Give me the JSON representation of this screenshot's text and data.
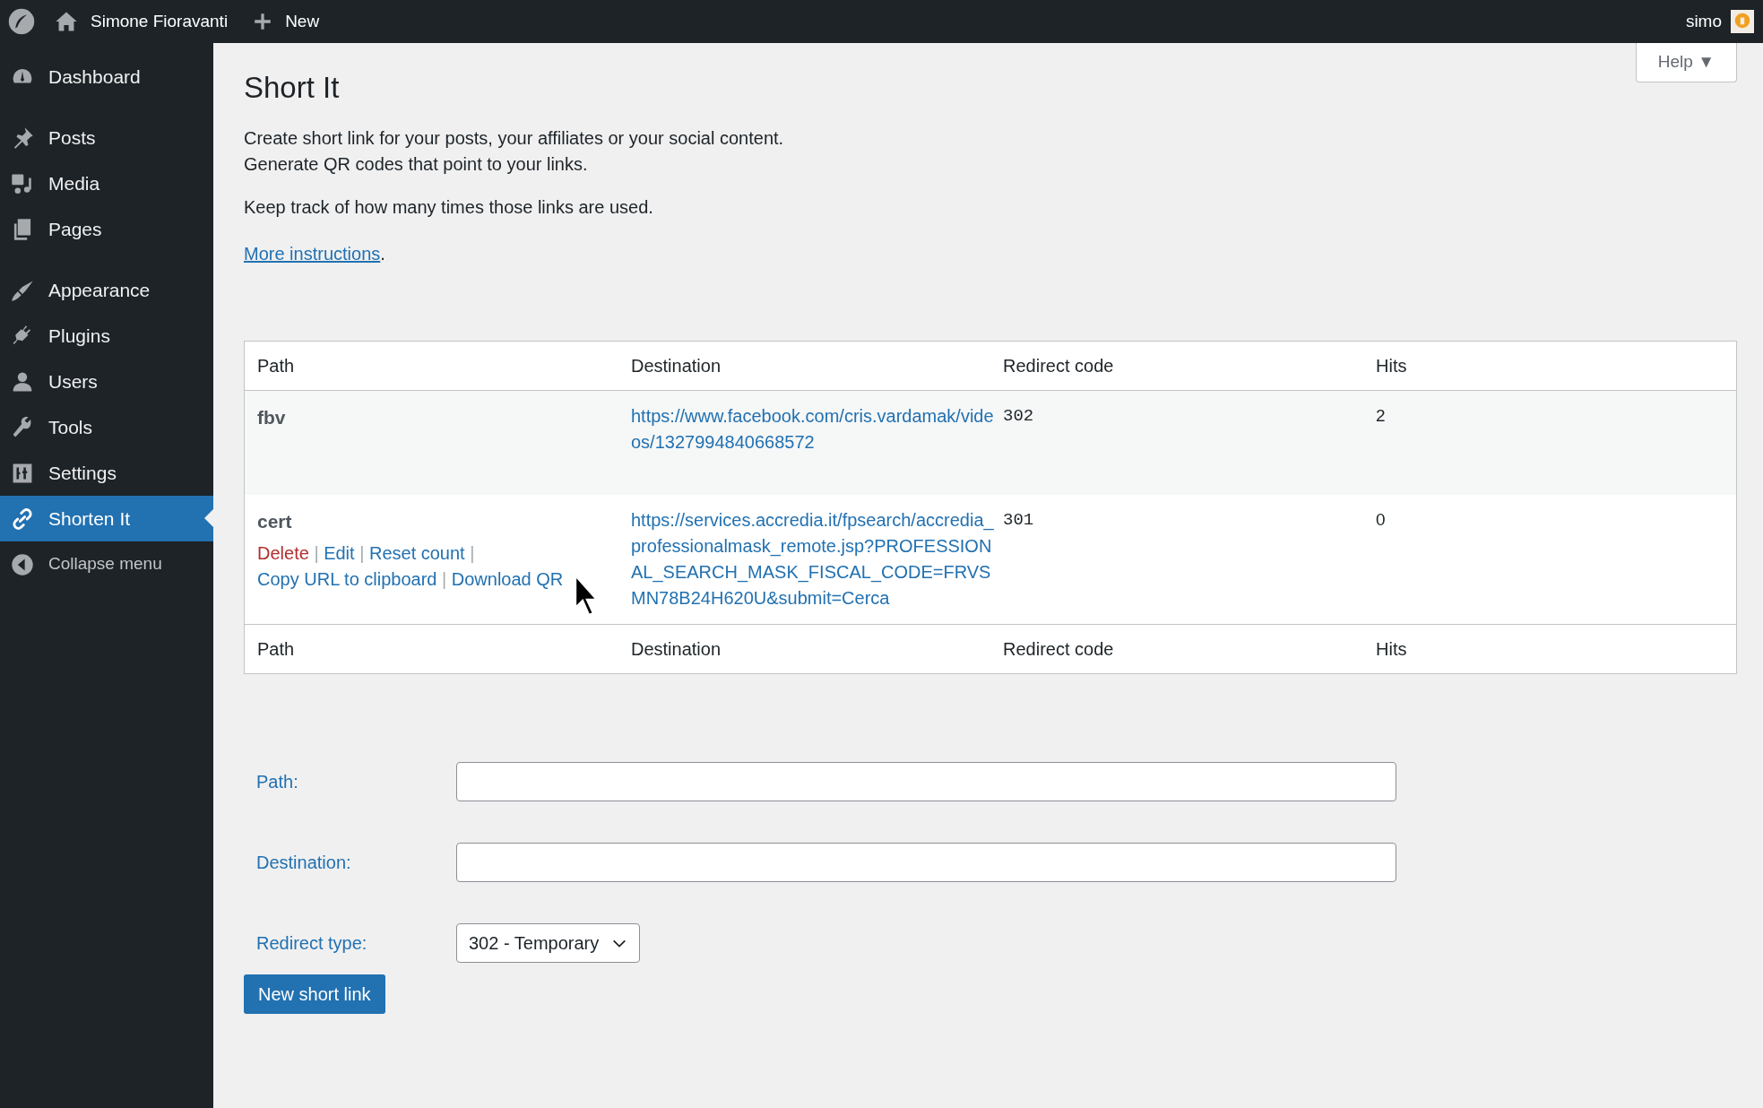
{
  "admin_bar": {
    "site_name": "Simone Fioravanti",
    "new_label": "New",
    "user": "simo"
  },
  "sidebar": {
    "items": [
      {
        "label": "Dashboard",
        "selected": false
      },
      {
        "label": "Posts",
        "selected": false
      },
      {
        "label": "Media",
        "selected": false
      },
      {
        "label": "Pages",
        "selected": false
      },
      {
        "label": "Appearance",
        "selected": false
      },
      {
        "label": "Plugins",
        "selected": false
      },
      {
        "label": "Users",
        "selected": false
      },
      {
        "label": "Tools",
        "selected": false
      },
      {
        "label": "Settings",
        "selected": false
      },
      {
        "label": "Shorten It",
        "selected": true
      }
    ],
    "collapse_label": "Collapse menu"
  },
  "help_button": "Help ▼",
  "page": {
    "title": "Short It",
    "intro_lines": [
      "Create short link for your posts, your affiliates or your social content.",
      "Generate QR codes that point to your links."
    ],
    "note": "Keep track of how many times those links are used.",
    "link": "More instructions",
    "link_suffix": "."
  },
  "table": {
    "columns": [
      "Path",
      "Destination",
      "Redirect code",
      "Hits"
    ],
    "rows": [
      {
        "path": "fbv",
        "destination": "https://www.facebook.com/cris.vardamak/videos/1327994840668572",
        "code": "302",
        "hits": "2",
        "actions": []
      },
      {
        "path": "cert",
        "destination": "https://services.accredia.it/fpsearch/accredia_professionalmask_remote.jsp?PROFESSIONAL_SEARCH_MASK_FISCAL_CODE=FRVSMN78B24H620U&submit=Cerca",
        "code": "301",
        "hits": "0",
        "actions": [
          {
            "label": "Delete",
            "kind": "danger"
          },
          {
            "label": "Edit",
            "kind": "link"
          },
          {
            "label": "Reset count",
            "kind": "link"
          },
          {
            "label": "Copy URL to clipboard",
            "kind": "link"
          },
          {
            "label": "Download QR",
            "kind": "link"
          }
        ],
        "separator": "|"
      }
    ],
    "footer_columns": [
      "Path",
      "Destination",
      "Redirect code",
      "Hits"
    ]
  },
  "form": {
    "fields": [
      {
        "label": "Path:",
        "kind": "text"
      },
      {
        "label": "Destination:",
        "kind": "text"
      },
      {
        "label": "Redirect type:",
        "kind": "select",
        "value": "302 - Temporary"
      }
    ],
    "submit": "New short link"
  }
}
